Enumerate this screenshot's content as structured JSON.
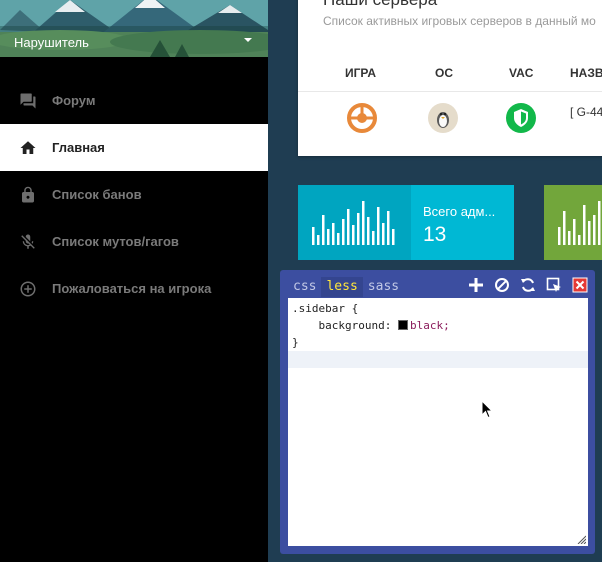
{
  "sidebar": {
    "profile_name": "Нарушитель",
    "items": [
      {
        "label": "Форум",
        "icon": "forum-icon",
        "active": false
      },
      {
        "label": "Главная",
        "icon": "home-icon",
        "active": true
      },
      {
        "label": "Список банов",
        "icon": "lock-icon",
        "active": false
      },
      {
        "label": "Список мутов/гагов",
        "icon": "mic-off-icon",
        "active": false
      },
      {
        "label": "Пожаловаться на игрока",
        "icon": "add-circle-icon",
        "active": false
      }
    ]
  },
  "servers": {
    "title": "Наши сервера",
    "subtitle": "Список активных игровых серверов в данный мо",
    "columns": [
      "ИГРА",
      "ОС",
      "VAC",
      "НАЗВ"
    ],
    "rows": [
      {
        "game_icon": "csgo-icon",
        "os_icon": "linux-icon",
        "vac_icon": "vac-shield-icon",
        "name": "[ G-44"
      }
    ]
  },
  "stats": [
    {
      "label": "Всего адм...",
      "value": "13",
      "color": "#00b8d4"
    },
    {
      "label": "",
      "value": "",
      "color": "#7cb342"
    }
  ],
  "editor": {
    "tabs": [
      "css",
      "less",
      "sass"
    ],
    "active_tab": "less",
    "tools": [
      "add-icon",
      "block-icon",
      "refresh-icon",
      "select-element-icon",
      "close-icon"
    ],
    "code": {
      "line1": ".sidebar {",
      "prop": "background:",
      "value": "black;",
      "line3": "}"
    }
  },
  "colors": {
    "sidebar_bg": "#000000",
    "main_bg": "#1f3d52",
    "editor_bg": "#3c4ea0",
    "active_tab": "#ffe63c",
    "stat_blue": "#00b8d4",
    "stat_green": "#7cb342"
  }
}
